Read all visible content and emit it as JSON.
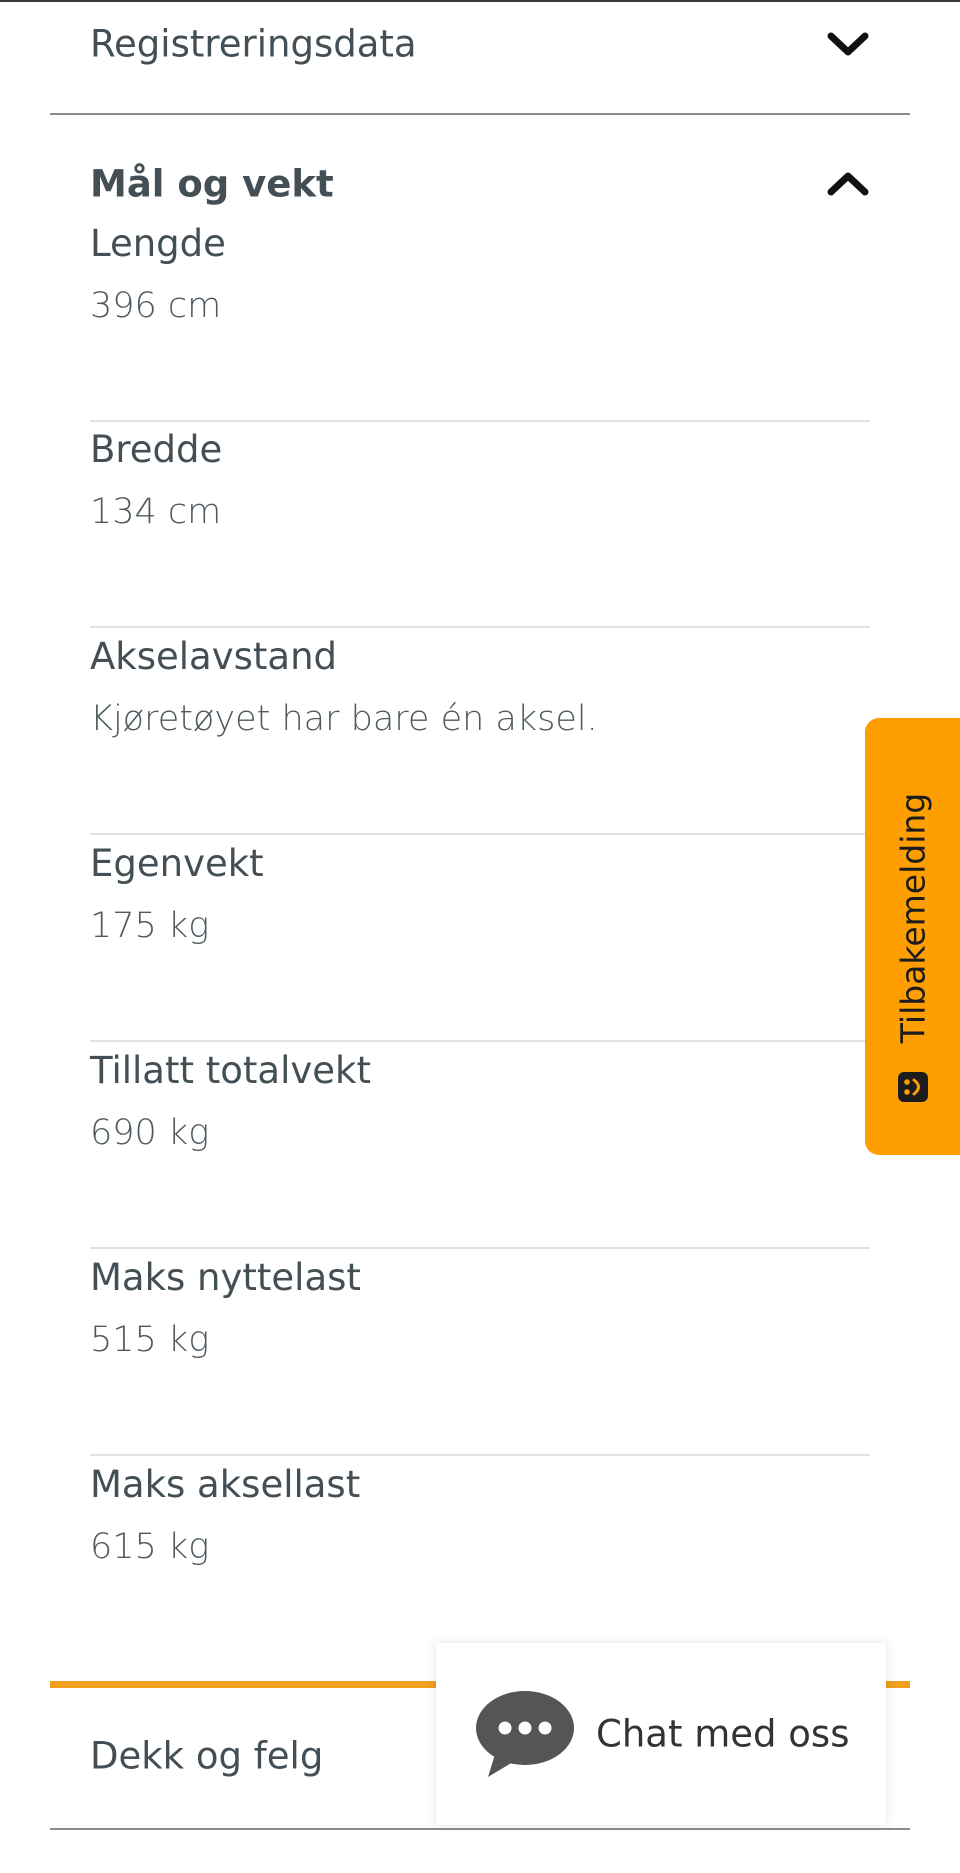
{
  "sections": {
    "registreringsdata": {
      "title": "Registreringsdata",
      "expanded": false,
      "icon": "chevron-down-icon"
    },
    "mal_og_vekt": {
      "title": "Mål og vekt",
      "expanded": true,
      "icon": "chevron-up-icon",
      "fields": [
        {
          "label": "Lengde",
          "value": "396 cm"
        },
        {
          "label": "Bredde",
          "value": "134 cm"
        },
        {
          "label": "Akselavstand",
          "value": "Kjøretøyet har bare én aksel."
        },
        {
          "label": "Egenvekt",
          "value": "175 kg"
        },
        {
          "label": "Tillatt totalvekt",
          "value": "690 kg"
        },
        {
          "label": "Maks nyttelast",
          "value": "515 kg"
        },
        {
          "label": "Maks aksellast",
          "value": "615 kg"
        }
      ]
    },
    "dekk_og_felg": {
      "title": "Dekk og felg",
      "expanded": false
    }
  },
  "feedback": {
    "label": "Tilbakemelding",
    "icon": "smiley-icon",
    "color": "#ff9e00"
  },
  "chat": {
    "label": "Chat med oss",
    "icon": "chat-bubble-icon"
  },
  "colors": {
    "accent": "#f0a01e",
    "text": "#444f55"
  }
}
